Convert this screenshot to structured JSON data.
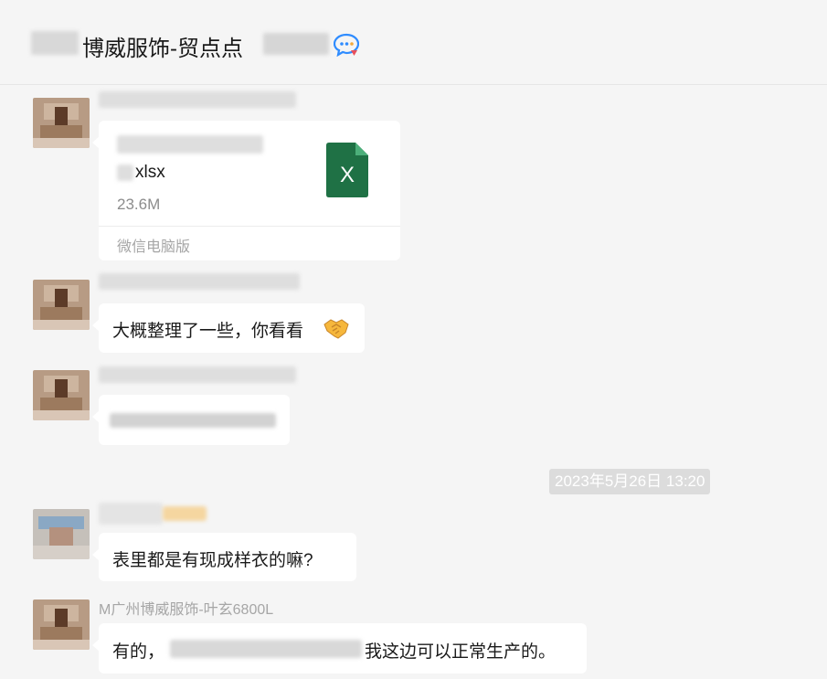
{
  "header": {
    "title": "博威服饰-贸点点",
    "chat_icon": "chat-bubble-icon"
  },
  "messages": [
    {
      "type": "file",
      "file": {
        "name_line2": "xlsx",
        "size": "23.6M",
        "source": "微信电脑版",
        "icon": "excel-file-icon"
      }
    },
    {
      "type": "text",
      "text": "大概整理了一些，你看看",
      "emoji": "handshake-emoji"
    },
    {
      "type": "text-blurred"
    },
    {
      "type": "timestamp",
      "text": "2023年5月26日 13:20"
    },
    {
      "type": "text",
      "text": "表里都是有现成样衣的嘛?"
    },
    {
      "type": "text",
      "sender": "M广州博威服饰-叶玄6800L",
      "text_prefix": "有的，",
      "text_suffix": "我这边可以正常生产的。"
    }
  ],
  "colors": {
    "background": "#f5f5f5",
    "bubble": "#ffffff",
    "excel_green": "#1f7145",
    "timestamp_bg": "#dcdcdc"
  }
}
